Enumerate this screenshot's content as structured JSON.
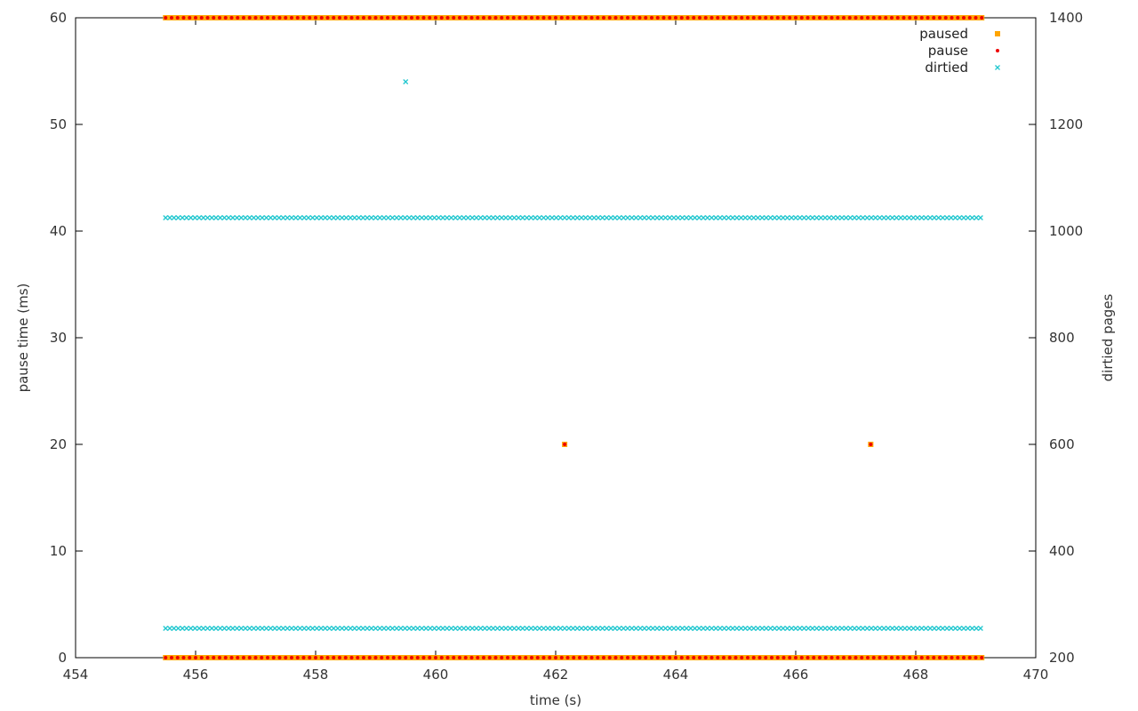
{
  "chart_data": {
    "type": "scatter",
    "xlabel": "time (s)",
    "ylabel": "pause time (ms)",
    "y2label": "dirtied pages",
    "xlim": [
      454,
      470
    ],
    "ylim": [
      0,
      60
    ],
    "y2lim": [
      200,
      1400
    ],
    "xticks": [
      454,
      456,
      458,
      460,
      462,
      464,
      466,
      468,
      470
    ],
    "yticks": [
      0,
      10,
      20,
      30,
      40,
      50,
      60
    ],
    "y2ticks": [
      200,
      400,
      600,
      800,
      1000,
      1200,
      1400
    ],
    "grid": false,
    "legend": "top-right",
    "colors": {
      "paused": "#ffa500",
      "pause": "#ee0000",
      "dirtied": "#22c7cf"
    },
    "series": [
      {
        "name": "paused",
        "axis": "left",
        "marker": "square",
        "band_x": [
          455.5,
          469.1
        ],
        "band_y": [
          0,
          60
        ],
        "band_step": 0.05,
        "points": [
          [
            462.15,
            20
          ],
          [
            467.25,
            20
          ]
        ]
      },
      {
        "name": "pause",
        "axis": "left",
        "marker": "dot",
        "band_x": [
          455.5,
          469.1
        ],
        "band_y": [
          0,
          60
        ],
        "band_step": 0.1,
        "points": [
          [
            462.15,
            20
          ],
          [
            467.25,
            20
          ]
        ]
      },
      {
        "name": "dirtied",
        "axis": "right",
        "marker": "cross",
        "band_x": [
          455.5,
          469.1
        ],
        "band_y": [
          1025,
          255
        ],
        "band_step": 0.07,
        "points": [
          [
            459.5,
            1280
          ]
        ]
      }
    ]
  }
}
